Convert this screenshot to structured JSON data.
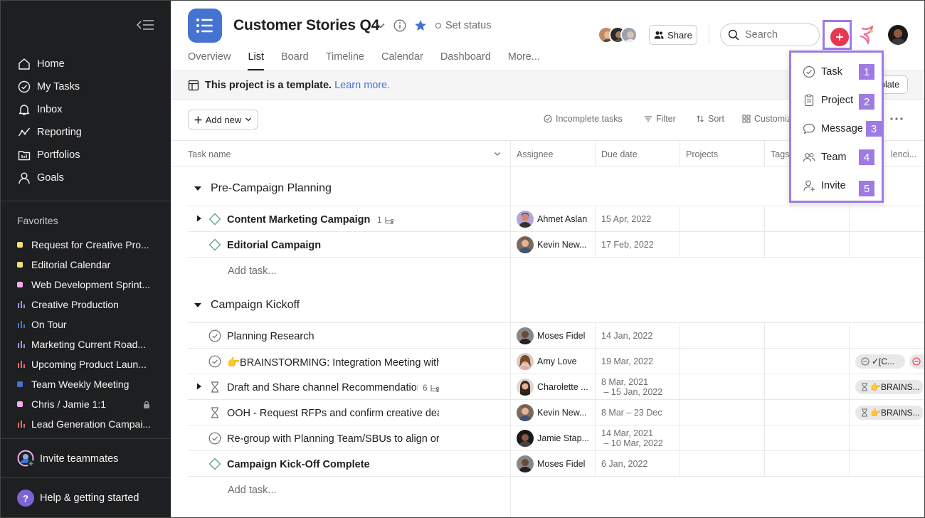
{
  "sidebar": {
    "nav": [
      {
        "label": "Home",
        "icon": "home-icon"
      },
      {
        "label": "My Tasks",
        "icon": "check-circle-icon"
      },
      {
        "label": "Inbox",
        "icon": "bell-icon"
      },
      {
        "label": "Reporting",
        "icon": "trend-line-icon"
      },
      {
        "label": "Portfolios",
        "icon": "folder-icon"
      },
      {
        "label": "Goals",
        "icon": "person-icon"
      }
    ],
    "favorites_title": "Favorites",
    "favorites": [
      {
        "label": "Request for Creative Pro...",
        "kind": "dot",
        "color": "#f8df72"
      },
      {
        "label": "Editorial Calendar",
        "kind": "dot",
        "color": "#f8df72"
      },
      {
        "label": "Web Development Sprint...",
        "kind": "dot",
        "color": "#f9aaef"
      },
      {
        "label": "Creative Production",
        "kind": "bars",
        "color": "#9e97e3"
      },
      {
        "label": "On Tour",
        "kind": "bars",
        "color": "#4573d2"
      },
      {
        "label": "Marketing Current Road...",
        "kind": "bars",
        "color": "#9e97e3"
      },
      {
        "label": "Upcoming Product Laun...",
        "kind": "bars",
        "color": "#f06a6a"
      },
      {
        "label": "Team Weekly Meeting",
        "kind": "dot",
        "color": "#4573d2"
      },
      {
        "label": "Chris / Jamie 1:1",
        "kind": "dot",
        "color": "#f9aaef",
        "locked": true
      },
      {
        "label": "Lead Generation Campai...",
        "kind": "bars",
        "color": "#f06a6a"
      }
    ],
    "invite_label": "Invite teammates",
    "help_label": "Help & getting started",
    "help_glyph": "?"
  },
  "header": {
    "title": "Customer Stories Q4",
    "set_status": "Set status",
    "tabs": [
      "Overview",
      "List",
      "Board",
      "Timeline",
      "Calendar",
      "Dashboard",
      "More..."
    ],
    "active_tab": "List",
    "share_label": "Share",
    "search_placeholder": "Search"
  },
  "banner": {
    "text": "This project is a template.",
    "link": "Learn more.",
    "button_label": "plate"
  },
  "toolbar": {
    "add_new": "Add new",
    "incomplete": "Incomplete tasks",
    "filter": "Filter",
    "sort": "Sort",
    "customize": "Customiz"
  },
  "columns": [
    "Task name",
    "Assignee",
    "Due date",
    "Projects",
    "Tags",
    "lenci..."
  ],
  "sections": [
    {
      "title": "Pre-Campaign Planning",
      "add_task": "Add task...",
      "rows": [
        {
          "name": "Content Marketing Campaign",
          "bold": true,
          "status": "milestone",
          "expand": true,
          "subtasks": "1",
          "assignee": "Ahmet Aslan",
          "due": [
            "15 Apr, 2022"
          ]
        },
        {
          "name": "Editorial Campaign",
          "bold": true,
          "status": "milestone",
          "expand": false,
          "subtasks": "",
          "assignee": "Kevin New...",
          "due": [
            "17 Feb, 2022"
          ]
        }
      ]
    },
    {
      "title": "Campaign Kickoff",
      "add_task": "Add task...",
      "rows": [
        {
          "name": "Planning Research",
          "bold": false,
          "status": "check",
          "expand": false,
          "subtasks": "",
          "assignee": "Moses Fidel",
          "due": [
            "14 Jan, 2022"
          ]
        },
        {
          "name": "👉BRAINSTORMING: Integration Meeting with",
          "bold": false,
          "status": "check",
          "expand": false,
          "subtasks": "",
          "assignee": "Amy Love",
          "due": [
            "19 Mar, 2022"
          ],
          "pill": "✓[C..."
        },
        {
          "name": "Draft and Share channel Recommendation",
          "bold": false,
          "status": "hourglass",
          "expand": true,
          "subtasks": "6",
          "assignee": "Charolette ...",
          "due": [
            "8 Mar, 2021",
            " – 15 Jan, 2022"
          ],
          "pill": "👉BRAINS..."
        },
        {
          "name": "OOH - Request RFPs and confirm creative dea",
          "bold": false,
          "status": "hourglass",
          "expand": false,
          "subtasks": "",
          "assignee": "Kevin New...",
          "due": [
            "8 Mar – 23 Dec"
          ],
          "pill": "👉BRAINS..."
        },
        {
          "name": "Re-group with Planning Team/SBUs to align or",
          "bold": false,
          "status": "check",
          "expand": false,
          "subtasks": "",
          "assignee": "Jamie Stap...",
          "due": [
            "14 Mar, 2021",
            " – 10 Mar, 2022"
          ]
        },
        {
          "name": "Campaign Kick-Off Complete",
          "bold": true,
          "status": "milestone",
          "expand": false,
          "subtasks": "",
          "assignee": "Moses Fidel",
          "due": [
            "6 Jan, 2022"
          ]
        }
      ]
    }
  ],
  "quick_add_menu": [
    {
      "label": "Task",
      "number": "1",
      "icon": "check-circle-icon"
    },
    {
      "label": "Project",
      "number": "2",
      "icon": "clipboard-icon"
    },
    {
      "label": "Message",
      "number": "3",
      "icon": "speech-bubble-icon"
    },
    {
      "label": "Team",
      "number": "4",
      "icon": "team-icon"
    },
    {
      "label": "Invite",
      "number": "5",
      "icon": "add-person-icon"
    }
  ],
  "colors": {
    "sidebar_bg": "#1e1f21",
    "project_icon": "#4573d2",
    "plus_button": "#e8384f",
    "highlight": "#9e7be3",
    "milestone": "#5da283",
    "link": "#4573d2"
  }
}
